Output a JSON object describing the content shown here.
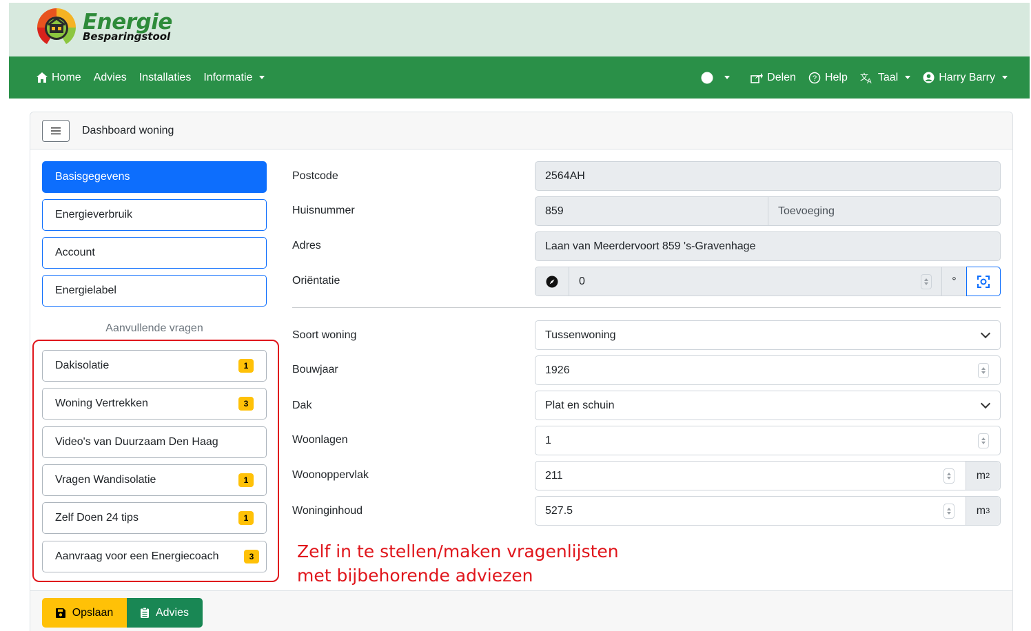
{
  "brand": {
    "title": "Energie",
    "subtitle": "Besparingstool"
  },
  "nav": {
    "left": [
      "Home",
      "Advies",
      "Installaties",
      "Informatie"
    ],
    "share": "Delen",
    "help": "Help",
    "language": "Taal",
    "user": "Harry Barry"
  },
  "card": {
    "title": "Dashboard woning"
  },
  "sidebar": {
    "main": [
      "Basisgegevens",
      "Energieverbruik",
      "Account",
      "Energielabel"
    ],
    "extra_heading": "Aanvullende vragen",
    "extra": [
      {
        "label": "Dakisolatie",
        "badge": "1"
      },
      {
        "label": "Woning Vertrekken",
        "badge": "3"
      },
      {
        "label": "Video's van Duurzaam Den Haag",
        "badge": ""
      },
      {
        "label": "Vragen Wandisolatie",
        "badge": "1"
      },
      {
        "label": "Zelf Doen 24 tips",
        "badge": "1"
      },
      {
        "label": "Aanvraag voor een Energiecoach",
        "badge": "3"
      }
    ]
  },
  "form": {
    "postcode": {
      "label": "Postcode",
      "value": "2564AH"
    },
    "huisnummer": {
      "label": "Huisnummer",
      "value": "859",
      "toevoeging_placeholder": "Toevoeging"
    },
    "adres": {
      "label": "Adres",
      "value": "Laan van Meerdervoort 859 's-Gravenhage"
    },
    "orientatie": {
      "label": "Oriëntatie",
      "value": "0",
      "unit": "°"
    },
    "soort": {
      "label": "Soort woning",
      "value": "Tussenwoning"
    },
    "bouwjaar": {
      "label": "Bouwjaar",
      "value": "1926"
    },
    "dak": {
      "label": "Dak",
      "value": "Plat en schuin"
    },
    "woonlagen": {
      "label": "Woonlagen",
      "value": "1"
    },
    "oppervlak": {
      "label": "Woonoppervlak",
      "value": "211",
      "unit": "m",
      "unit_sup": "2"
    },
    "inhoud": {
      "label": "Woninginhoud",
      "value": "527.5",
      "unit": "m",
      "unit_sup": "3"
    }
  },
  "annotation": [
    "Zelf in te stellen/maken vragenlijsten",
    "met bijbehorende adviezen"
  ],
  "footer": {
    "save": "Opslaan",
    "advies": "Advies"
  },
  "colors": {
    "nav_green": "#2a9048",
    "primary": "#0d6efd",
    "badge": "#ffc107",
    "annotation_red": "#e0161c"
  }
}
